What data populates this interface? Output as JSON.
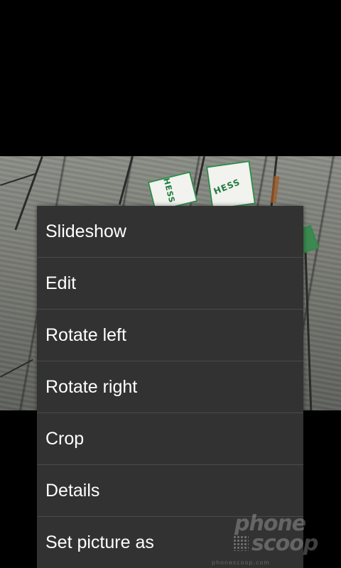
{
  "menu": {
    "items": [
      {
        "label": "Slideshow"
      },
      {
        "label": "Edit"
      },
      {
        "label": "Rotate left"
      },
      {
        "label": "Rotate right"
      },
      {
        "label": "Crop"
      },
      {
        "label": "Details"
      },
      {
        "label": "Set picture as"
      }
    ]
  },
  "photo": {
    "box_label": "HESS"
  },
  "watermark": {
    "line1": "phone",
    "line2": "scoop",
    "url": "phonescoop.com"
  },
  "colors": {
    "background": "#000000",
    "menu_background": "#323232",
    "menu_divider": "#4a4a4a",
    "menu_text": "#ffffff",
    "box_accent": "#2f8a4a"
  }
}
